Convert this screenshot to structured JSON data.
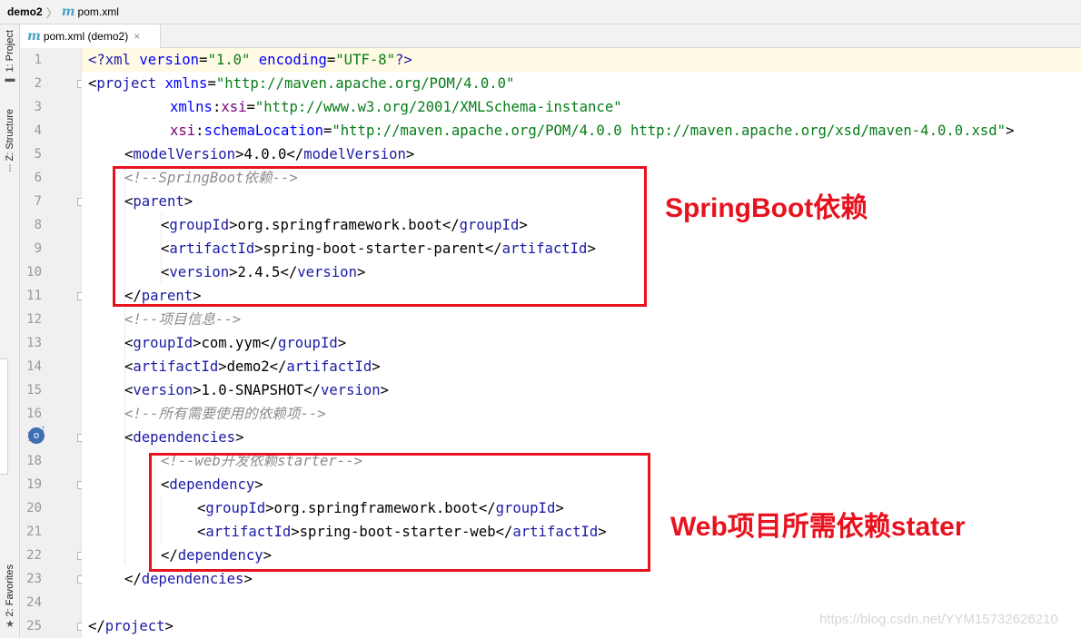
{
  "breadcrumb": {
    "project": "demo2",
    "sep": "〉",
    "file_icon": "m",
    "file": "pom.xml"
  },
  "left_toolbar": {
    "project_tab": "1: Project",
    "structure_tab": "Z: Structure",
    "favorites_tab": "2: Favorites"
  },
  "editor_tab": {
    "icon": "m",
    "label": "pom.xml (demo2)",
    "close": "×"
  },
  "gutter": {
    "line_numbers": [
      "1",
      "2",
      "3",
      "4",
      "5",
      "6",
      "7",
      "8",
      "9",
      "10",
      "11",
      "12",
      "13",
      "14",
      "15",
      "16",
      "17",
      "18",
      "19",
      "20",
      "21",
      "22",
      "23",
      "24",
      "25"
    ],
    "run_icon": "o",
    "run_icon_arrow": "↑"
  },
  "code": {
    "l1": [
      "<?",
      "xml ",
      "version",
      "=",
      "\"1.0\"",
      " ",
      "encoding",
      "=",
      "\"UTF-8\"",
      "?>"
    ],
    "l2": [
      "<",
      "project ",
      "xmlns",
      "=",
      "\"http://maven.apache.org/POM/4.0.0\""
    ],
    "l3": [
      "xmlns",
      ":",
      "xsi",
      "=",
      "\"http://www.w3.org/2001/XMLSchema-instance\""
    ],
    "l4": [
      "xsi",
      ":",
      "schemaLocation",
      "=",
      "\"http://maven.apache.org/POM/4.0.0 http://maven.apache.org/xsd/maven-4.0.0.xsd\"",
      ">"
    ],
    "l5": [
      "<",
      "modelVersion",
      ">",
      "4.0.0",
      "</",
      "modelVersion",
      ">"
    ],
    "l6": "<!--SpringBoot依赖-->",
    "l7": [
      "<",
      "parent",
      ">"
    ],
    "l8": [
      "<",
      "groupId",
      ">",
      "org.springframework.boot",
      "</",
      "groupId",
      ">"
    ],
    "l9": [
      "<",
      "artifactId",
      ">",
      "spring-boot-starter-parent",
      "</",
      "artifactId",
      ">"
    ],
    "l10": [
      "<",
      "version",
      ">",
      "2.4.5",
      "</",
      "version",
      ">"
    ],
    "l11": [
      "</",
      "parent",
      ">"
    ],
    "l12": "<!--项目信息-->",
    "l13": [
      "<",
      "groupId",
      ">",
      "com.yym",
      "</",
      "groupId",
      ">"
    ],
    "l14": [
      "<",
      "artifactId",
      ">",
      "demo2",
      "</",
      "artifactId",
      ">"
    ],
    "l15": [
      "<",
      "version",
      ">",
      "1.0-SNAPSHOT",
      "</",
      "version",
      ">"
    ],
    "l16": "<!--所有需要使用的依赖项-->",
    "l17": [
      "<",
      "dependencies",
      ">"
    ],
    "l18": "<!--web开发依赖starter-->",
    "l19": [
      "<",
      "dependency",
      ">"
    ],
    "l20": [
      "<",
      "groupId",
      ">",
      "org.springframework.boot",
      "</",
      "groupId",
      ">"
    ],
    "l21": [
      "<",
      "artifactId",
      ">",
      "spring-boot-starter-web",
      "</",
      "artifactId",
      ">"
    ],
    "l22": [
      "</",
      "dependency",
      ">"
    ],
    "l23": [
      "</",
      "dependencies",
      ">"
    ],
    "l25": [
      "</",
      "project",
      ">"
    ]
  },
  "annotations": {
    "springboot": "SpringBoot依赖",
    "web": "Web项目所需依赖stater"
  },
  "watermark": "https://blog.csdn.net/YYM15732626210",
  "colors": {
    "annotation_red": "#e8121f",
    "tag": "#1a1aa6",
    "string": "#067d17",
    "comment": "#8c8c8c"
  }
}
